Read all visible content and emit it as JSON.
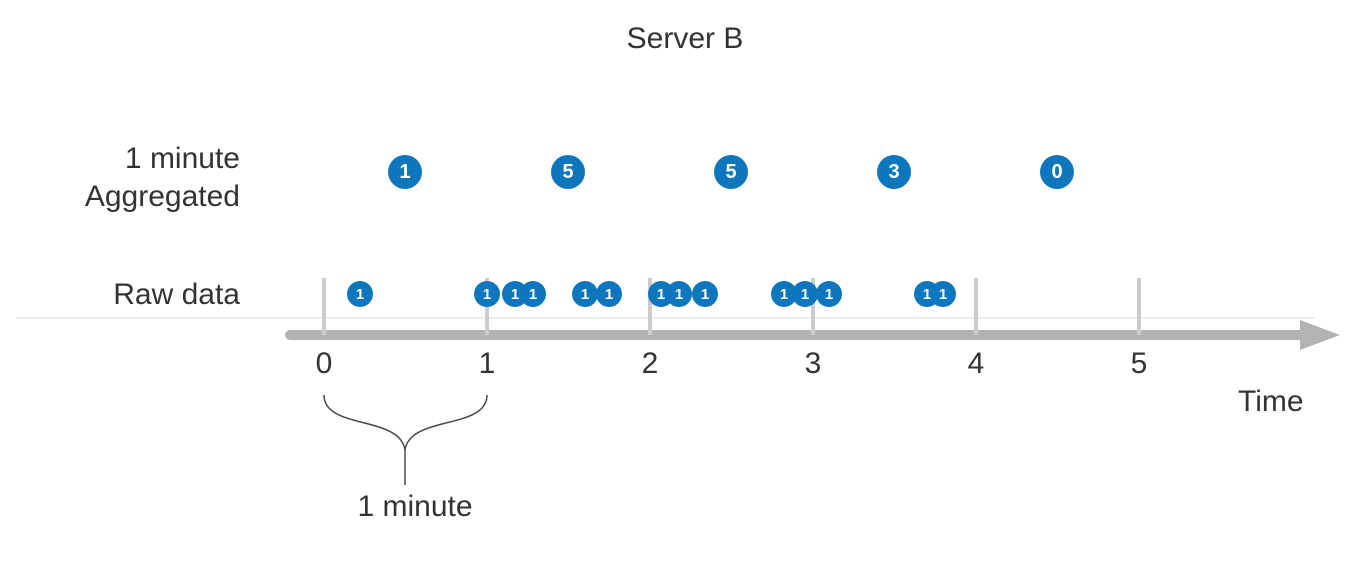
{
  "title": "Server B",
  "labels": {
    "aggregated_line1": "1 minute",
    "aggregated_line2": "Aggregated",
    "raw": "Raw data",
    "x_axis": "Time",
    "brace": "1 minute"
  },
  "colors": {
    "circle_fill": "#0e76bc",
    "circle_text": "#ffffff",
    "axis": "#b3b3b3",
    "tick_minor": "#cccccc",
    "faint_line": "#ededed"
  },
  "chart_data": {
    "type": "timeline",
    "x_axis_label": "Time",
    "x_ticks": [
      0,
      1,
      2,
      3,
      4,
      5
    ],
    "brace_interval": {
      "from": 0,
      "to": 1,
      "label": "1 minute"
    },
    "aggregated_per_minute": [
      {
        "minute": 0,
        "value": 1
      },
      {
        "minute": 1,
        "value": 5
      },
      {
        "minute": 2,
        "value": 5
      },
      {
        "minute": 3,
        "value": 3
      },
      {
        "minute": 4,
        "value": 0
      }
    ],
    "raw_events": [
      {
        "t": 0.22,
        "value": 1
      },
      {
        "t": 1.0,
        "value": 1
      },
      {
        "t": 1.17,
        "value": 1
      },
      {
        "t": 1.28,
        "value": 1
      },
      {
        "t": 1.6,
        "value": 1
      },
      {
        "t": 1.75,
        "value": 1
      },
      {
        "t": 2.07,
        "value": 1
      },
      {
        "t": 2.18,
        "value": 1
      },
      {
        "t": 2.34,
        "value": 1
      },
      {
        "t": 2.82,
        "value": 1
      },
      {
        "t": 2.95,
        "value": 1
      },
      {
        "t": 3.1,
        "value": 1
      },
      {
        "t": 3.7,
        "value": 1
      },
      {
        "t": 3.8,
        "value": 1
      }
    ]
  },
  "ticks": {
    "t0": "0",
    "t1": "1",
    "t2": "2",
    "t3": "3",
    "t4": "4",
    "t5": "5"
  },
  "aggregated": {
    "v0": "1",
    "v1": "5",
    "v2": "5",
    "v3": "3",
    "v4": "0"
  },
  "raw": {
    "r0": "1",
    "r1": "1",
    "r2": "1",
    "r3": "1",
    "r4": "1",
    "r5": "1",
    "r6": "1",
    "r7": "1",
    "r8": "1",
    "r9": "1",
    "r10": "1",
    "r11": "1",
    "r12": "1",
    "r13": "1"
  }
}
